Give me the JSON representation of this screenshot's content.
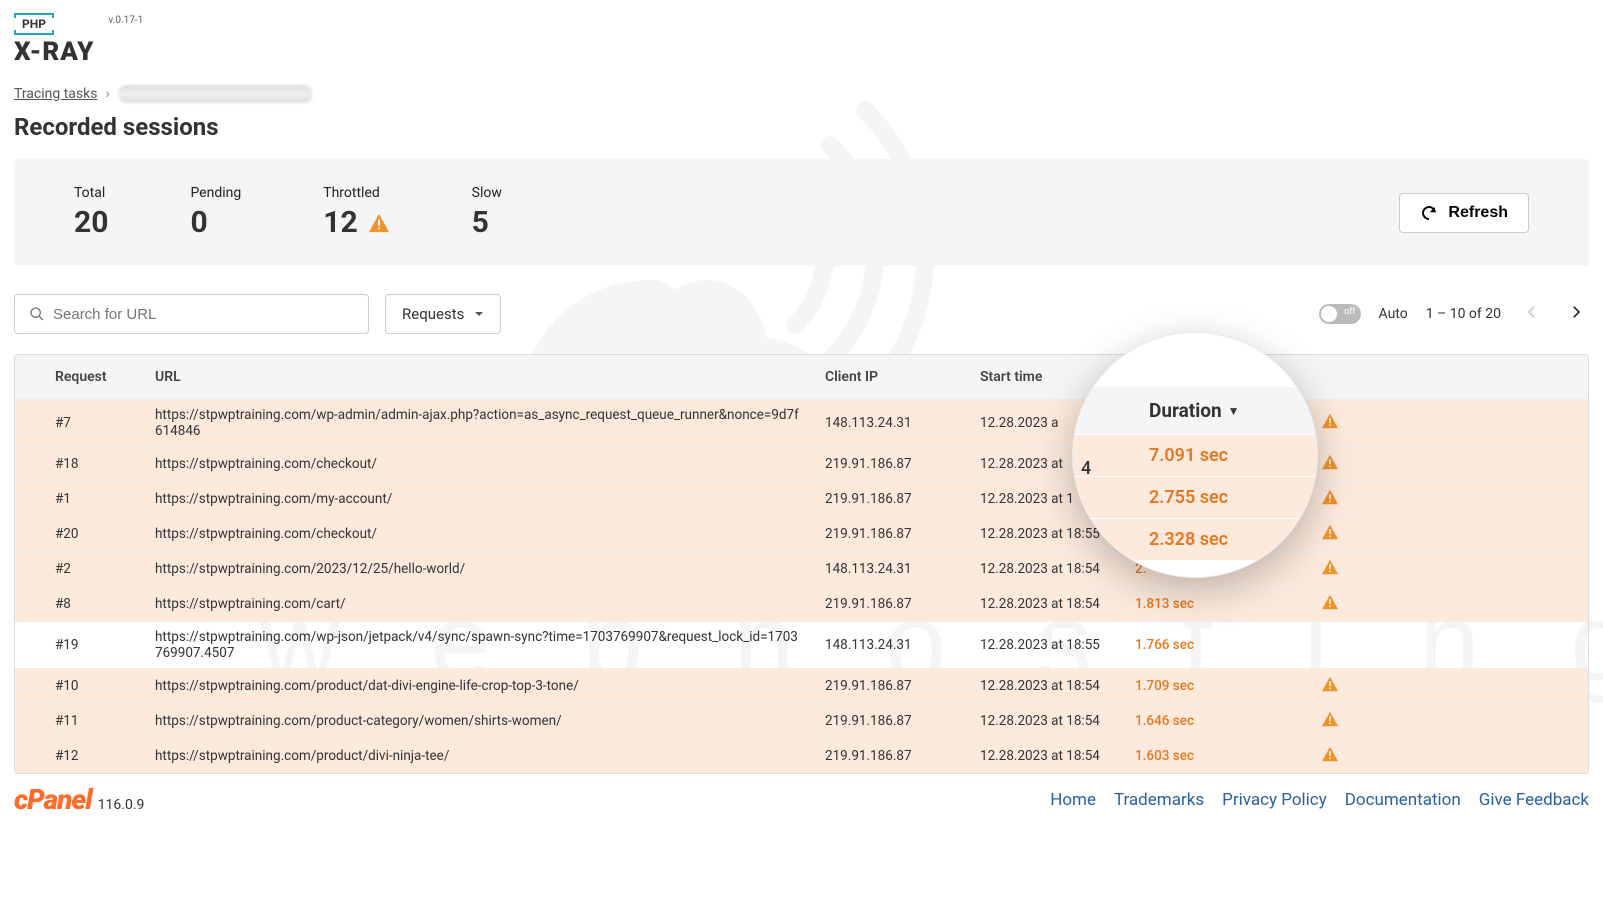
{
  "app": {
    "php": "PHP",
    "xray": "X-RAY",
    "version": "v.0.17-1"
  },
  "breadcrumb": {
    "root": "Tracing tasks"
  },
  "heading": "Recorded sessions",
  "stats": {
    "total": {
      "label": "Total",
      "value": "20"
    },
    "pending": {
      "label": "Pending",
      "value": "0"
    },
    "throttled": {
      "label": "Throttled",
      "value": "12"
    },
    "slow": {
      "label": "Slow",
      "value": "5"
    }
  },
  "refresh": "Refresh",
  "search": {
    "placeholder": "Search for URL"
  },
  "dropdown": {
    "label": "Requests"
  },
  "toggle": {
    "state": "off",
    "label": "Auto"
  },
  "pagination": {
    "text": "1 – 10 of 20"
  },
  "columns": {
    "request": "Request",
    "url": "URL",
    "ip": "Client IP",
    "time": "Start time",
    "duration": "Duration"
  },
  "rows": [
    {
      "req": "#7",
      "url": "https://stpwptraining.com/wp-admin/admin-ajax.php?action=as_async_request_queue_runner&nonce=9d7f614846",
      "ip": "148.113.24.31",
      "time": "12.28.2023 a",
      "dur": "",
      "warn": true
    },
    {
      "req": "#18",
      "url": "https://stpwptraining.com/checkout/",
      "ip": "219.91.186.87",
      "time": "12.28.2023 at",
      "dur": "",
      "warn": true
    },
    {
      "req": "#1",
      "url": "https://stpwptraining.com/my-account/",
      "ip": "219.91.186.87",
      "time": "12.28.2023 at 1",
      "dur": "",
      "warn": true
    },
    {
      "req": "#20",
      "url": "https://stpwptraining.com/checkout/",
      "ip": "219.91.186.87",
      "time": "12.28.2023 at 18:55",
      "dur": "",
      "warn": true
    },
    {
      "req": "#2",
      "url": "https://stpwptraining.com/2023/12/25/hello-world/",
      "ip": "148.113.24.31",
      "time": "12.28.2023 at 18:54",
      "dur": "2.",
      "warn": true
    },
    {
      "req": "#8",
      "url": "https://stpwptraining.com/cart/",
      "ip": "219.91.186.87",
      "time": "12.28.2023 at 18:54",
      "dur": "1.813 sec",
      "warn": true
    },
    {
      "req": "#19",
      "url": "https://stpwptraining.com/wp-json/jetpack/v4/sync/spawn-sync?time=1703769907&request_lock_id=1703769907.4507",
      "ip": "148.113.24.31",
      "time": "12.28.2023 at 18:55",
      "dur": "1.766 sec",
      "warn": false
    },
    {
      "req": "#10",
      "url": "https://stpwptraining.com/product/dat-divi-engine-life-crop-top-3-tone/",
      "ip": "219.91.186.87",
      "time": "12.28.2023 at 18:54",
      "dur": "1.709 sec",
      "warn": true
    },
    {
      "req": "#11",
      "url": "https://stpwptraining.com/product-category/women/shirts-women/",
      "ip": "219.91.186.87",
      "time": "12.28.2023 at 18:54",
      "dur": "1.646 sec",
      "warn": true
    },
    {
      "req": "#12",
      "url": "https://stpwptraining.com/product/divi-ninja-tee/",
      "ip": "219.91.186.87",
      "time": "12.28.2023 at 18:54",
      "dur": "1.603 sec",
      "warn": true
    }
  ],
  "lens": {
    "header": "Duration",
    "side_num": "4",
    "values": [
      "7.091 sec",
      "2.755 sec",
      "2.328 sec"
    ]
  },
  "footer": {
    "brand": "cPanel",
    "version": "116.0.9",
    "links": [
      "Home",
      "Trademarks",
      "Privacy Policy",
      "Documentation",
      "Give Feedback"
    ]
  }
}
